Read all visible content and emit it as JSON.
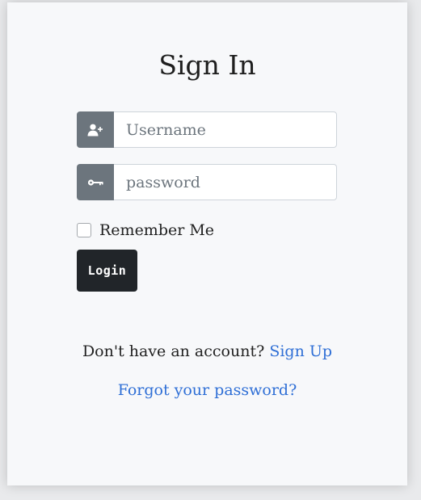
{
  "form": {
    "title": "Sign In",
    "username": {
      "placeholder": "Username",
      "value": "",
      "icon": "user-plus-icon"
    },
    "password": {
      "placeholder": "password",
      "value": "",
      "icon": "key-icon"
    },
    "remember_label": "Remember Me",
    "remember_checked": false,
    "login_label": "Login"
  },
  "footer": {
    "signup_prompt": "Don't have an account?",
    "signup_link": "Sign Up",
    "forgot_link": "Forgot your password?"
  },
  "colors": {
    "addon_bg": "#6c757d",
    "button_bg": "#212529",
    "link": "#2f6fd6",
    "card_bg": "#f7f8fa"
  }
}
